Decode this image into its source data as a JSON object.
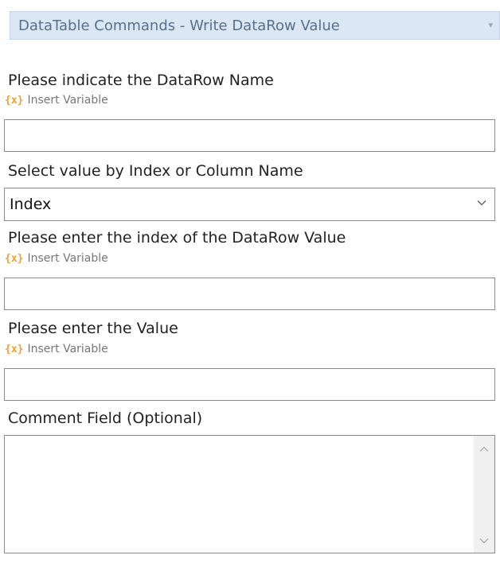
{
  "command": {
    "selected": "DataTable Commands - Write DataRow Value",
    "arrow_icon": "dropdown-arrow-icon"
  },
  "fields": {
    "datarow_name": {
      "label": "Please indicate the DataRow Name",
      "insert_variable": "Insert Variable",
      "value": ""
    },
    "select_mode": {
      "label": "Select value by Index or Column Name",
      "selected": "Index"
    },
    "index": {
      "label": "Please enter the index of the DataRow Value",
      "insert_variable": "Insert Variable",
      "value": ""
    },
    "value": {
      "label": "Please enter the Value",
      "insert_variable": "Insert Variable",
      "value": ""
    },
    "comment": {
      "label": "Comment Field (Optional)",
      "value": ""
    }
  },
  "icons": {
    "variable": "{x}"
  },
  "colors": {
    "combo_bg": "#dce7f5",
    "variable_icon": "#f0a030"
  }
}
